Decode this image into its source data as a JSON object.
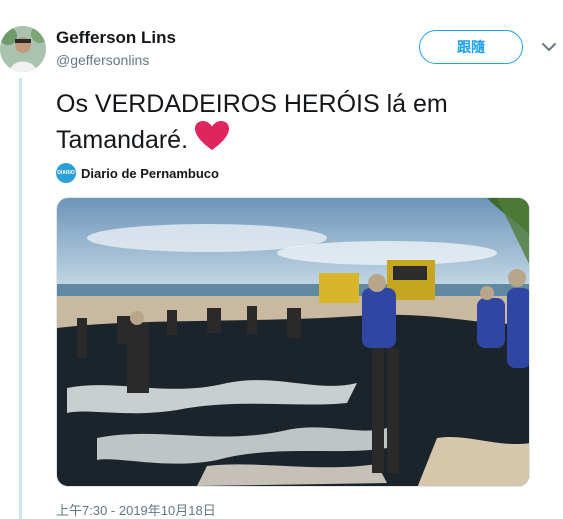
{
  "tweet": {
    "author_name": "Gefferson Lins",
    "author_handle": "@geffersonlins",
    "follow_label": "跟隨",
    "text": "Os VERDADEIROS HERÓIS lá em Tamandaré.",
    "emoji": "heart-icon",
    "source_logo_text": "DIARIO",
    "source_name": "Diario de Pernambuco",
    "timestamp": "上午7:30 - 2019年10月18日"
  },
  "media": {
    "description_icon": "photo",
    "sky_color": "#9fc3d8",
    "sea_color": "#3f6f86",
    "oil_color": "#1c242b",
    "foam_color": "#e8ecef",
    "sand_color": "#c9b9a0",
    "jersey_color": "#2f47a3"
  },
  "colors": {
    "accent": "#1da1f2",
    "heart": "#e0245e",
    "thread": "#cfe6f4"
  }
}
